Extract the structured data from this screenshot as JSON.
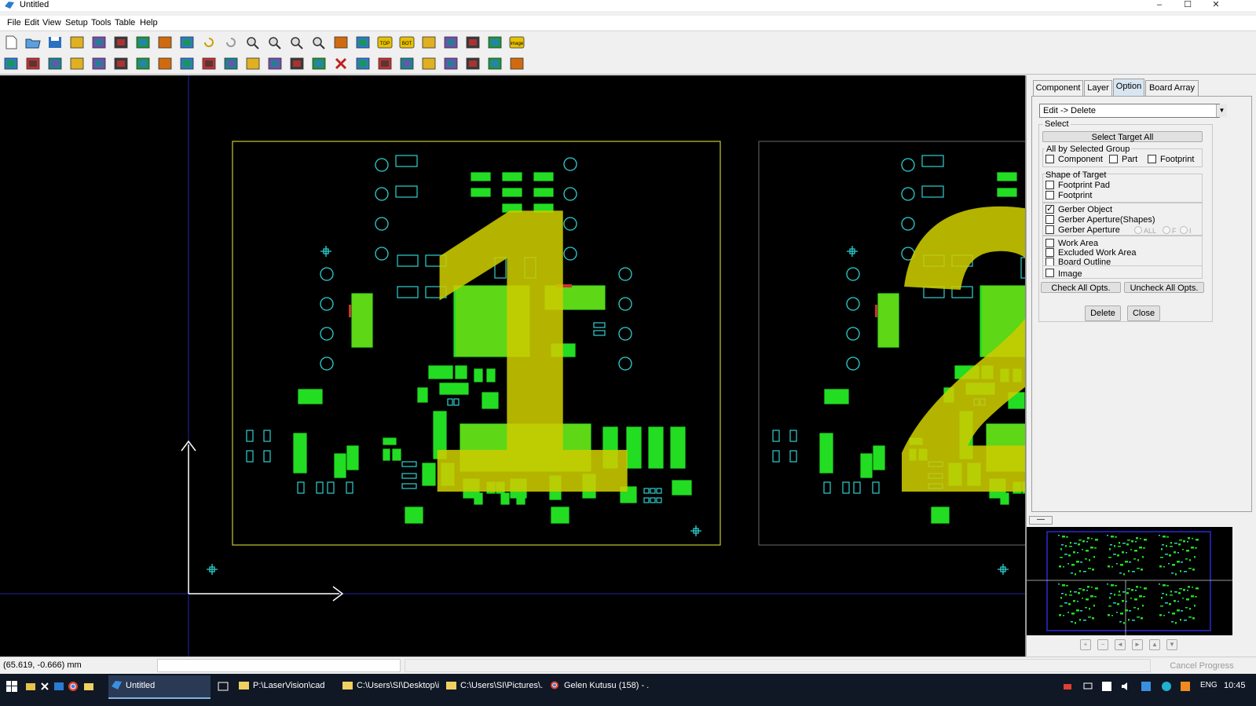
{
  "window": {
    "title": "Untitled",
    "minimize": "–",
    "maximize": "☐",
    "close": "✕"
  },
  "menu": [
    "File",
    "Edit",
    "View",
    "Setup",
    "Tools",
    "Table",
    "Help"
  ],
  "toolbar_icons": {
    "row1": [
      "new-file-icon",
      "open-folder-icon",
      "save-icon",
      "import-icon",
      "export-icon",
      "convert-icon",
      "transfer-icon",
      "grid-icon",
      "fit-icon",
      "undo-icon",
      "redo-icon",
      "zoom-in-icon",
      "zoom-out-icon",
      "zoom-window-icon",
      "zoom-all-icon",
      "layout-icon",
      "measure-icon",
      "top-view-icon",
      "bottom-view-icon",
      "panelize-icon",
      "fiducial-icon",
      "process-icon",
      "stencil-icon",
      "image-icon"
    ],
    "row2": [
      "edit-pad-icon",
      "cut-icon",
      "select-icon",
      "merge-icon",
      "component-icon",
      "array-icon",
      "pattern-icon",
      "rotate-icon",
      "move-icon",
      "gear-icon",
      "align-icon",
      "mirror-icon",
      "target-icon",
      "flash-icon",
      "mark-icon",
      "delete-x-icon",
      "resize-icon",
      "transform-icon",
      "bridge-icon",
      "group-icon",
      "split-icon",
      "copy-icon",
      "paste-icon",
      "table-icon"
    ]
  },
  "top_toolbar_labels": {
    "top": "TOP",
    "bot": "BOT",
    "image": "image"
  },
  "board_labels": {
    "left": "1",
    "right": "2"
  },
  "panel": {
    "tabs": [
      "Component",
      "Layer",
      "Option",
      "Board Array"
    ],
    "active_tab": "Option",
    "mode": "Edit -> Delete",
    "select_group": "Select",
    "select_target_all": "Select Target All",
    "all_by_selected_group": "All by Selected Group",
    "group_opts": [
      {
        "label": "Component",
        "checked": false
      },
      {
        "label": "Part",
        "checked": false
      },
      {
        "label": "Footprint",
        "checked": false
      }
    ],
    "shape_of_target": "Shape of Target",
    "shape_opts": [
      {
        "label": "Footprint Pad",
        "checked": false
      },
      {
        "label": "Footprint",
        "checked": false
      }
    ],
    "gerber_opts": [
      {
        "label": "Gerber Object",
        "checked": true
      },
      {
        "label": "Gerber Aperture(Shapes)",
        "checked": false
      },
      {
        "label": "Gerber Aperture",
        "checked": false
      }
    ],
    "aperture_radios": [
      "ALL",
      "F",
      "I"
    ],
    "area_opts": [
      {
        "label": "Work Area",
        "checked": false
      },
      {
        "label": "Excluded Work Area",
        "checked": false
      },
      {
        "label": "Board Outline",
        "checked": false
      }
    ],
    "image_opt": {
      "label": "Image",
      "checked": false
    },
    "check_all": "Check All Opts.",
    "uncheck_all": "Uncheck All Opts.",
    "delete": "Delete",
    "close": "Close",
    "collapse": "—",
    "nav": [
      "+",
      "−",
      "◄",
      "►",
      "▲",
      "▼"
    ]
  },
  "status": {
    "coords": "(65.619, -0.666) mm",
    "cancel": "Cancel Progress"
  },
  "taskbar": {
    "items": [
      {
        "label": "Untitled",
        "active": true
      },
      {
        "label": "P:\\LaserVision\\cad",
        "active": false
      },
      {
        "label": "C:\\Users\\SI\\Desktop\\i...",
        "active": false
      },
      {
        "label": "C:\\Users\\SI\\Pictures\\...",
        "active": false
      },
      {
        "label": "Gelen Kutusu (158) - ...",
        "active": false
      }
    ],
    "lang": "ENG",
    "time": "10:45"
  },
  "colors": {
    "pad_green": "#22dd22",
    "silk_yellow": "#cccc00",
    "outline_cyan": "#2fd0d0",
    "axis": "#ffffff"
  }
}
